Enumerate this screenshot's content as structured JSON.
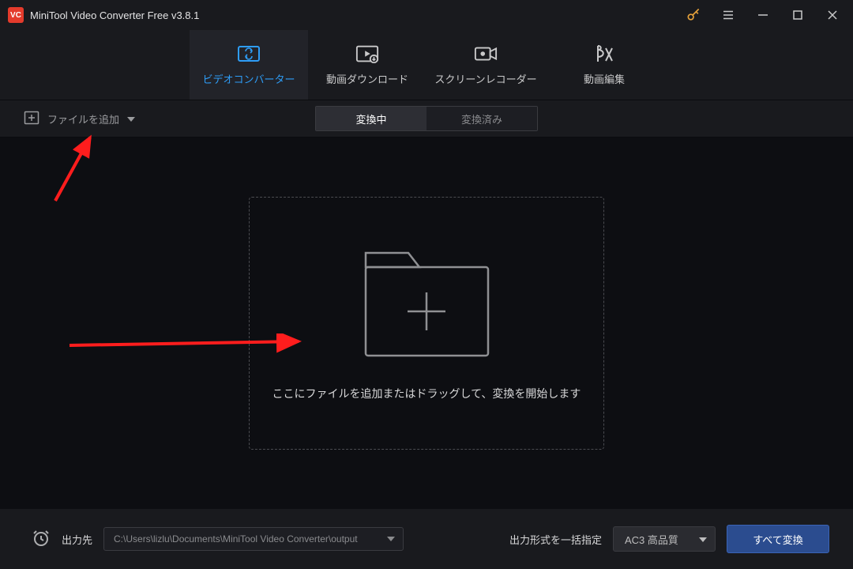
{
  "titlebar": {
    "app_name": "MiniTool Video Converter Free v3.8.1"
  },
  "tabs": [
    {
      "label": "ビデオコンバーター"
    },
    {
      "label": "動画ダウンロード"
    },
    {
      "label": "スクリーンレコーダー"
    },
    {
      "label": "動画編集"
    }
  ],
  "toolbar": {
    "add_file_label": "ファイルを追加"
  },
  "segmented": {
    "converting": "変換中",
    "converted": "変換済み"
  },
  "dropzone": {
    "text": "ここにファイルを追加またはドラッグして、変換を開始します"
  },
  "bottom": {
    "output_dest_label": "出力先",
    "output_path": "C:\\Users\\lizlu\\Documents\\MiniTool Video Converter\\output",
    "output_format_label": "出力形式を一括指定",
    "format_value": "AC3 高品質",
    "convert_all_label": "すべて変換"
  },
  "colors": {
    "accent_blue": "#2e9df7",
    "warn_orange": "#e5a13b",
    "button_blue": "#2b4c8f",
    "annotation_red": "#ff1d1d"
  }
}
